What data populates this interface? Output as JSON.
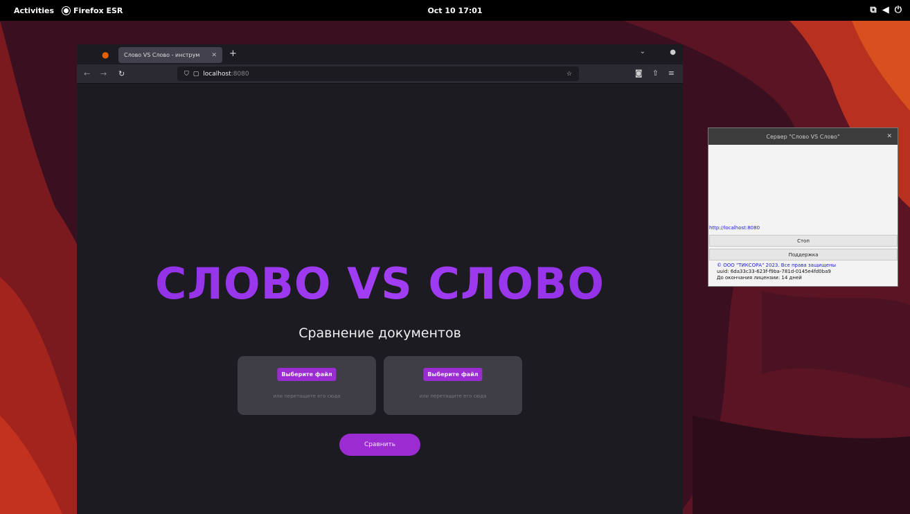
{
  "topbar": {
    "activities": "Activities",
    "app_name": "Firefox ESR",
    "clock": "Oct 10  17:01",
    "tray_icons": [
      "network-icon",
      "volume-icon",
      "power-icon"
    ]
  },
  "browser": {
    "tab_title": "Слово VS Слово - инструм",
    "tab_close": "✕",
    "new_tab": "+",
    "url_host": "localhost",
    "url_port": ":8080"
  },
  "page": {
    "title": "СЛОВО VS СЛОВО",
    "subtitle": "Сравнение документов",
    "file_button_left": "Выберите файл",
    "file_button_right": "Выберите файл",
    "drop_hint_left": "или перетащите его сюда",
    "drop_hint_right": "или перетащите его сюда",
    "compare_button": "Сравнить"
  },
  "dialog": {
    "title": "Сервер \"Слово VS Слово\"",
    "close": "✕",
    "link": "http://localhost:8080",
    "stop_button": "Стоп",
    "support_button": "Поддержка",
    "copyright": "© ООО \"ТИКСОРА\" 2023. Все права защищены",
    "uuid": "uuid: 6da33c33-623f-f9ba-781d-0145e4fd0ba9",
    "license": "До окончания лицензии: 14 дней"
  },
  "colors": {
    "accent": "#9b2cd1",
    "title_purple": "#9b30f0",
    "page_bg": "#1c1b22"
  }
}
